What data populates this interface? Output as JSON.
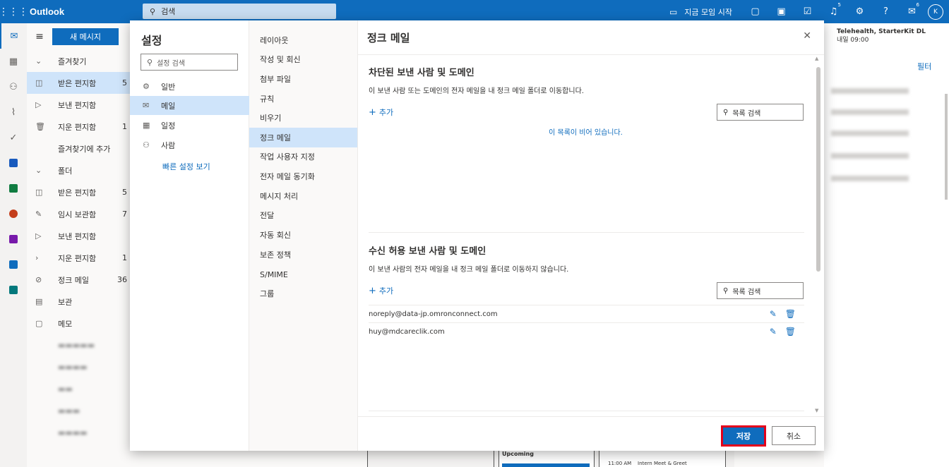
{
  "topbar": {
    "app_name": "Outlook",
    "search_placeholder": "검색",
    "meet_now": "지금 모임 시작",
    "notif_badge": "5",
    "feedback_badge": "6",
    "avatar_initial": "K"
  },
  "folders": {
    "new_message": "새 메시지",
    "items": [
      {
        "label": "즐겨찾기",
        "count": ""
      },
      {
        "label": "받은 편지함",
        "count": "5"
      },
      {
        "label": "보낸 편지함",
        "count": ""
      },
      {
        "label": "지운 편지함",
        "count": "1"
      },
      {
        "label": "즐겨찾기에 추가",
        "count": ""
      },
      {
        "label": "폴더",
        "count": ""
      },
      {
        "label": "받은 편지함",
        "count": "5"
      },
      {
        "label": "임시 보관함",
        "count": "7"
      },
      {
        "label": "보낸 편지함",
        "count": ""
      },
      {
        "label": "지운 편지함",
        "count": "1"
      },
      {
        "label": "정크 메일",
        "count": "36"
      },
      {
        "label": "보관",
        "count": ""
      },
      {
        "label": "메모",
        "count": ""
      }
    ]
  },
  "mail_bg": {
    "event_title": "Telehealth, StarterKit DL",
    "event_time": "내일 09:00",
    "filter": "필터"
  },
  "bottom_strip": {
    "upcoming": "Upcoming",
    "time": "11:00 AM",
    "event": "Intern Meet & Greet"
  },
  "settings": {
    "title": "설정",
    "search_placeholder": "설정 검색",
    "categories": [
      {
        "label": "일반",
        "icon": "gear-icon"
      },
      {
        "label": "메일",
        "icon": "mail-icon"
      },
      {
        "label": "일정",
        "icon": "calendar-icon"
      },
      {
        "label": "사람",
        "icon": "people-icon"
      }
    ],
    "quick_settings": "빠른 설정 보기",
    "mail_sections": [
      "레이아웃",
      "작성 및 회신",
      "첨부 파일",
      "규칙",
      "비우기",
      "정크 메일",
      "작업 사용자 지정",
      "전자 메일 동기화",
      "메시지 처리",
      "전달",
      "자동 회신",
      "보존 정책",
      "S/MIME",
      "그룹"
    ]
  },
  "junk": {
    "title": "정크 메일",
    "blocked": {
      "title": "차단된 보낸 사람 및 도메인",
      "desc": "이 보낸 사람 또는 도메인의 전자 메일을 내 정크 메일 폴더로 이동합니다.",
      "add": "추가",
      "search_placeholder": "목록 검색",
      "empty": "이 목록이 비어 있습니다."
    },
    "safe": {
      "title": "수신 허용 보낸 사람 및 도메인",
      "desc": "이 보낸 사람의 전자 메일을 내 정크 메일 폴더로 이동하지 않습니다.",
      "add": "추가",
      "search_placeholder": "목록 검색",
      "entries": [
        "noreply@data-jp.omronconnect.com",
        "huy@mdcareclik.com"
      ]
    },
    "save": "저장",
    "cancel": "취소"
  },
  "colors": {
    "accent": "#0f6cbd",
    "selected": "#cfe4fa",
    "highlight": "#e3001b"
  }
}
